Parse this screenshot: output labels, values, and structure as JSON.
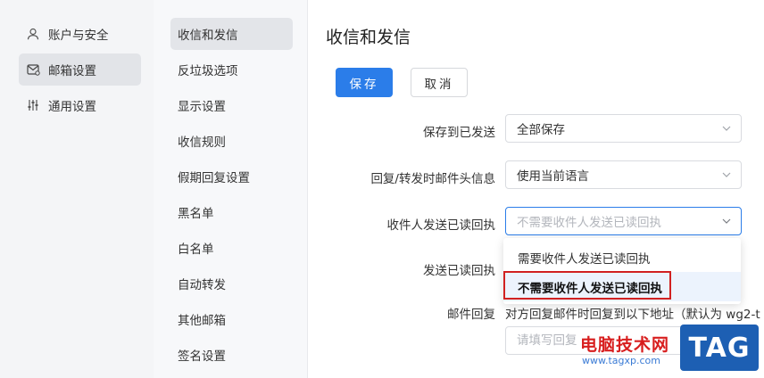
{
  "nav_primary": [
    {
      "label": "账户与安全",
      "icon": "user-icon"
    },
    {
      "label": "邮箱设置",
      "icon": "mail-settings-icon",
      "active": true
    },
    {
      "label": "通用设置",
      "icon": "sliders-icon"
    }
  ],
  "nav_secondary": [
    {
      "label": "收信和发信",
      "active": true
    },
    {
      "label": "反垃圾选项"
    },
    {
      "label": "显示设置"
    },
    {
      "label": "收信规则"
    },
    {
      "label": "假期回复设置"
    },
    {
      "label": "黑名单"
    },
    {
      "label": "白名单"
    },
    {
      "label": "自动转发"
    },
    {
      "label": "其他邮箱"
    },
    {
      "label": "签名设置"
    }
  ],
  "main": {
    "title": "收信和发信",
    "save_label": "保存",
    "cancel_label": "取消",
    "fields": {
      "save_sent": {
        "label": "保存到已发送",
        "value": "全部保存"
      },
      "reply_header": {
        "label": "回复/转发时邮件头信息",
        "value": "使用当前语言"
      },
      "recipient_receipt": {
        "label": "收件人发送已读回执",
        "placeholder": "不需要收件人发送已读回执"
      },
      "send_receipt": {
        "label": "发送已读回执"
      },
      "reply_mail": {
        "label": "邮件回复",
        "description": "对方回复邮件时回复到以下地址（默认为 wg2-t",
        "input_placeholder": "请填写回复"
      }
    },
    "dropdown_options": [
      "需要收件人发送已读回执",
      "不需要收件人发送已读回执"
    ]
  },
  "watermark": {
    "text": "电脑技术网",
    "url": "www.tagxp.com",
    "tag": "TAG"
  },
  "colors": {
    "accent": "#2b7de9",
    "highlight_box": "#d12121",
    "selected_option_bg": "#ecf3fd"
  }
}
